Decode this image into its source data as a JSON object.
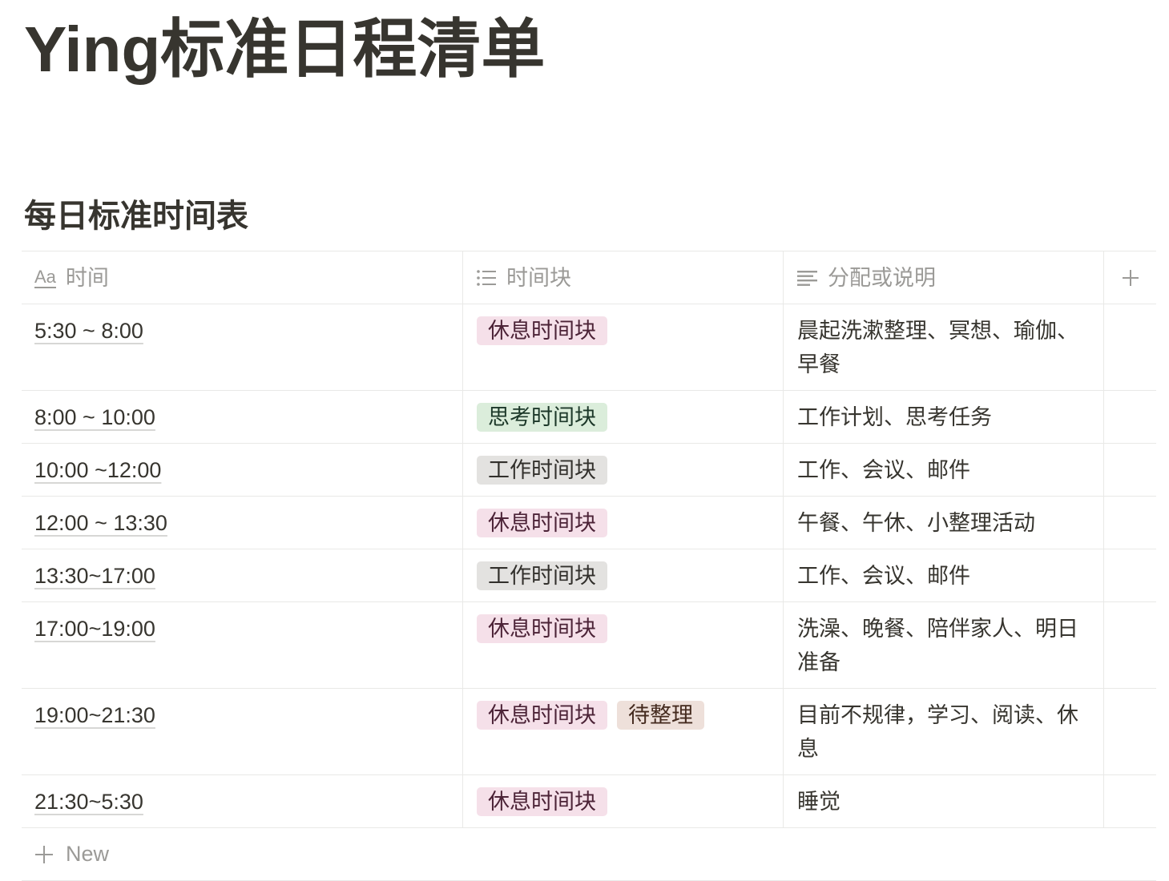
{
  "page": {
    "title": "Ying标准日程清单"
  },
  "database": {
    "title": "每日标准时间表",
    "columns": [
      {
        "name": "时间",
        "icon": "title-property-icon",
        "icon_glyph": "Aa"
      },
      {
        "name": "时间块",
        "icon": "multi-select-property-icon"
      },
      {
        "name": "分配或说明",
        "icon": "text-property-icon"
      }
    ],
    "add_property_icon": "plus-icon",
    "rows": [
      {
        "time": "5:30 ~ 8:00",
        "blocks": [
          {
            "label": "休息时间块",
            "color": "pink"
          }
        ],
        "note": "晨起洗漱整理、冥想、瑜伽、早餐"
      },
      {
        "time": "8:00 ~ 10:00",
        "blocks": [
          {
            "label": "思考时间块",
            "color": "green"
          }
        ],
        "note": "工作计划、思考任务"
      },
      {
        "time": "10:00 ~12:00",
        "blocks": [
          {
            "label": "工作时间块",
            "color": "gray"
          }
        ],
        "note": "工作、会议、邮件"
      },
      {
        "time": "12:00 ~ 13:30",
        "blocks": [
          {
            "label": "休息时间块",
            "color": "pink"
          }
        ],
        "note": "午餐、午休、小整理活动"
      },
      {
        "time": "13:30~17:00",
        "blocks": [
          {
            "label": "工作时间块",
            "color": "gray"
          }
        ],
        "note": "工作、会议、邮件"
      },
      {
        "time": "17:00~19:00",
        "blocks": [
          {
            "label": "休息时间块",
            "color": "pink"
          }
        ],
        "note": "洗澡、晚餐、陪伴家人、明日准备"
      },
      {
        "time": "19:00~21:30",
        "blocks": [
          {
            "label": "休息时间块",
            "color": "pink"
          },
          {
            "label": "待整理",
            "color": "brown"
          }
        ],
        "note": "目前不规律，学习、阅读、休息"
      },
      {
        "time": "21:30~5:30",
        "blocks": [
          {
            "label": "休息时间块",
            "color": "pink"
          }
        ],
        "note": "睡觉"
      }
    ],
    "new_row": {
      "icon": "plus-icon",
      "label": "New"
    }
  },
  "colors": {
    "text": "#37352f",
    "muted": "#9b9a97",
    "border": "#e9e9e7",
    "tags": {
      "pink": {
        "bg": "#f5e0e9",
        "fg": "#4c2337"
      },
      "green": {
        "bg": "#dbeddb",
        "fg": "#1c3829"
      },
      "gray": {
        "bg": "#e3e2e0",
        "fg": "#32302c"
      },
      "brown": {
        "bg": "#eee0da",
        "fg": "#442a1e"
      }
    }
  }
}
